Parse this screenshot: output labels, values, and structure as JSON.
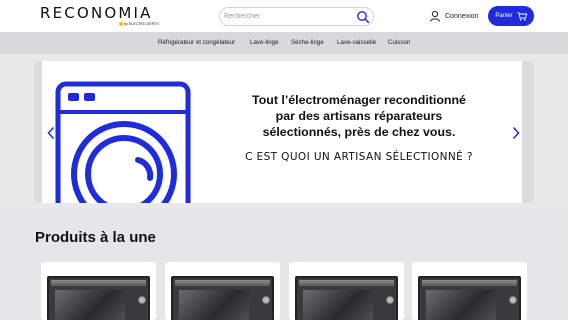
{
  "header": {
    "logo_text": "RECONOMIA",
    "logo_subtext": "by ELECTRO DEPOT",
    "search_placeholder": "Rechercher",
    "login_label": "Connexion",
    "cart_label": "Panier"
  },
  "categories": [
    "Réfrigérateur et congélateur",
    "Lave-linge",
    "Sèche-linge",
    "Lave-vaisselle",
    "Cuisson"
  ],
  "hero": {
    "headline_line1": "Tout l’électroménager reconditionné",
    "headline_line2": "par des artisans réparateurs",
    "headline_line3": "sélectionnés, près de chez vous.",
    "link_text": "C EST QUOI UN ARTISAN SÉLECTIONNÉ ?"
  },
  "products": {
    "title": "Produits à la une",
    "cards": [
      {
        "image": "oven-product-image"
      },
      {
        "image": "oven-product-image"
      },
      {
        "image": "oven-product-image"
      },
      {
        "image": "oven-product-image"
      }
    ]
  },
  "colors": {
    "accent": "#1f2cdc",
    "header_bg": "#ffffff",
    "nav_bg": "#d9d9dc"
  }
}
